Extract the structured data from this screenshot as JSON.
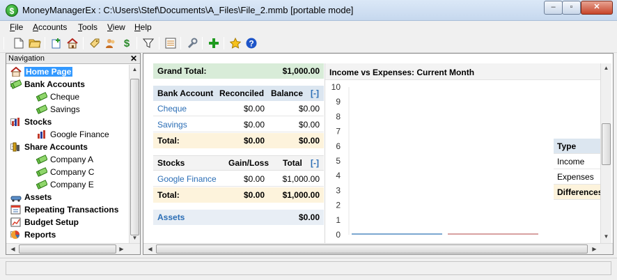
{
  "window": {
    "title": "MoneyManagerEx : C:\\Users\\Stef\\Documents\\A_Files\\File_2.mmb [portable mode]",
    "min_label": "–",
    "max_label": "▫",
    "close_label": "✕"
  },
  "menu": [
    "File",
    "Accounts",
    "Tools",
    "View",
    "Help"
  ],
  "toolbar_icons": [
    "new-file-icon",
    "open-folder-icon",
    "new-account-icon",
    "home-icon",
    "tag-icon",
    "users-icon",
    "dollar-icon",
    "filter-icon",
    "checklist-icon",
    "wrench-icon",
    "add-icon",
    "star-icon",
    "help-icon"
  ],
  "navigation": {
    "header": "Navigation",
    "close": "✕",
    "items": [
      {
        "label": "Home Page",
        "level": 0,
        "bold": true,
        "selected": true,
        "icon": "home-icon"
      },
      {
        "label": "Bank Accounts",
        "level": 0,
        "bold": true,
        "expander": "−",
        "icon": "money-icon"
      },
      {
        "label": "Cheque",
        "level": 1,
        "icon": "money-icon"
      },
      {
        "label": "Savings",
        "level": 1,
        "icon": "money-icon"
      },
      {
        "label": "Stocks",
        "level": 0,
        "bold": true,
        "expander": "−",
        "icon": "stocks-icon"
      },
      {
        "label": "Google Finance",
        "level": 1,
        "icon": "stocks-icon"
      },
      {
        "label": "Share Accounts",
        "level": 0,
        "bold": true,
        "expander": "−",
        "icon": "share-icon"
      },
      {
        "label": "Company A",
        "level": 1,
        "icon": "money-icon"
      },
      {
        "label": "Company C",
        "level": 1,
        "icon": "money-icon"
      },
      {
        "label": "Company E",
        "level": 1,
        "icon": "money-icon"
      },
      {
        "label": "Assets",
        "level": 0,
        "bold": true,
        "icon": "car-icon"
      },
      {
        "label": "Repeating Transactions",
        "level": 0,
        "bold": true,
        "icon": "calendar-icon"
      },
      {
        "label": "Budget Setup",
        "level": 0,
        "bold": true,
        "expander": "+",
        "icon": "budget-icon"
      },
      {
        "label": "Reports",
        "level": 0,
        "bold": true,
        "expander": "+",
        "icon": "pie-icon"
      }
    ]
  },
  "summary": {
    "grand_total_label": "Grand Total:",
    "grand_total_value": "$1,000.00",
    "bank": {
      "headers": [
        "Bank Account",
        "Reconciled",
        "Balance",
        "[-]"
      ],
      "rows": [
        {
          "name": "Cheque",
          "reconciled": "$0.00",
          "balance": "$0.00"
        },
        {
          "name": "Savings",
          "reconciled": "$0.00",
          "balance": "$0.00"
        }
      ],
      "total_label": "Total:",
      "total_reconciled": "$0.00",
      "total_balance": "$0.00"
    },
    "stocks": {
      "headers": [
        "Stocks",
        "Gain/Loss",
        "Total",
        "[-]"
      ],
      "rows": [
        {
          "name": "Google Finance",
          "gain": "$0.00",
          "total": "$1,000.00"
        }
      ],
      "total_label": "Total:",
      "total_gain": "$0.00",
      "total_total": "$1,000.00"
    },
    "assets": {
      "label": "Assets",
      "value": "$0.00"
    }
  },
  "chart_data": {
    "type": "bar",
    "title": "Income vs Expenses: Current Month",
    "categories": [
      "Income",
      "Expenses"
    ],
    "values": [
      0,
      0
    ],
    "ylim": [
      0,
      10
    ],
    "yticks": [
      "0",
      "1",
      "2",
      "3",
      "4",
      "5",
      "6",
      "7",
      "8",
      "9",
      "10"
    ],
    "colors": [
      "#7ba7d0",
      "#d8a0a0"
    ],
    "legend": {
      "header": "Type",
      "rows": [
        "Income",
        "Expenses",
        "Differences"
      ]
    }
  }
}
